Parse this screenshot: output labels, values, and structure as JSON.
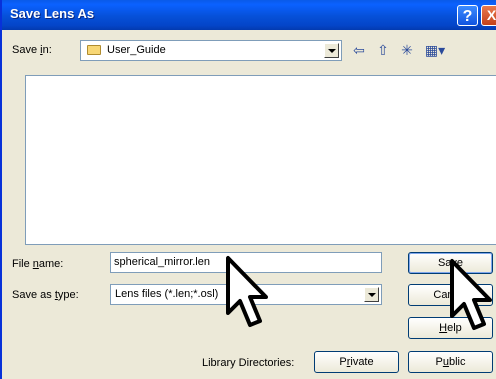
{
  "window": {
    "title": "Save Lens As",
    "help_glyph": "?",
    "close_glyph": "X"
  },
  "save_in": {
    "label_pre": "Save ",
    "label_underlined": "i",
    "label_post": "n:",
    "value": "User_Guide",
    "icon": "folder-icon"
  },
  "toolbar": {
    "icons": [
      "back-arrow-icon",
      "up-folder-icon",
      "new-folder-icon",
      "view-menu-icon"
    ],
    "back_glyph": "⇦",
    "up_glyph": "⇧",
    "new_glyph": "✳",
    "view_glyph": "▦▾"
  },
  "file_name": {
    "label_pre": "File ",
    "label_underlined": "n",
    "label_post": "ame:",
    "value": "spherical_mirror.len"
  },
  "save_as_type": {
    "label_pre": "Save as ",
    "label_underlined": "t",
    "label_post": "ype:",
    "value": "Lens files (*.len;*.osl)"
  },
  "buttons": {
    "save": {
      "pre": "Sa",
      "underlined": "v",
      "post": "e"
    },
    "cancel": "Cancel",
    "help": {
      "underlined": "H",
      "post": "elp"
    },
    "private": {
      "pre": "P",
      "underlined": "r",
      "post": "ivate"
    },
    "public": {
      "pre": "P",
      "underlined": "u",
      "post": "blic"
    }
  },
  "library_directories_label": "Library Directories:",
  "colors": {
    "title_bar": "#0650d8",
    "dialog_bg": "#ece9d8",
    "field_border": "#7f9db9"
  }
}
